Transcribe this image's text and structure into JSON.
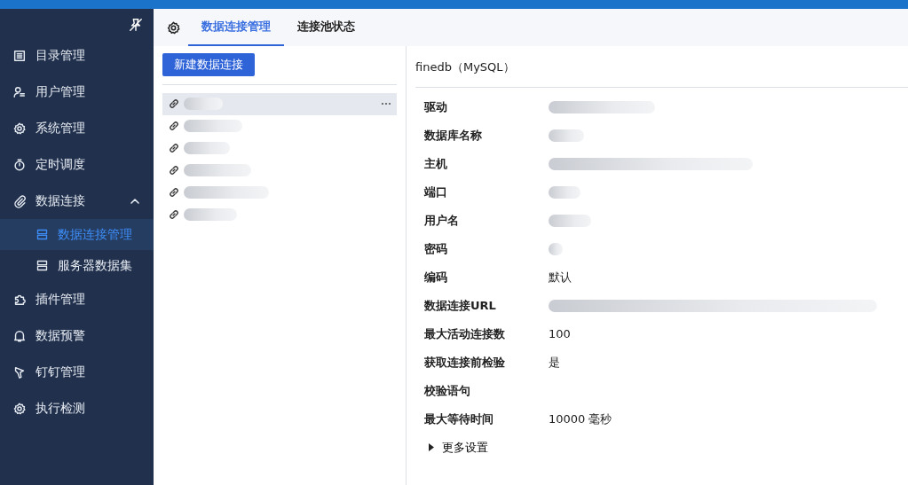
{
  "sidebar": {
    "items": [
      {
        "label": "目录管理"
      },
      {
        "label": "用户管理"
      },
      {
        "label": "系统管理"
      },
      {
        "label": "定时调度"
      },
      {
        "label": "数据连接",
        "expanded": true,
        "children": [
          {
            "label": "数据连接管理",
            "selected": true
          },
          {
            "label": "服务器数据集",
            "selected": false
          }
        ]
      },
      {
        "label": "插件管理"
      },
      {
        "label": "数据预警"
      },
      {
        "label": "钉钉管理"
      },
      {
        "label": "执行检测"
      }
    ]
  },
  "tabs": [
    {
      "label": "数据连接管理",
      "selected": true
    },
    {
      "label": "连接池状态",
      "selected": false
    }
  ],
  "new_button": "新建数据连接",
  "connections": [
    {
      "selected": true
    },
    {
      "selected": false
    },
    {
      "selected": false
    },
    {
      "selected": false
    },
    {
      "selected": false
    },
    {
      "selected": false
    }
  ],
  "detail": {
    "title": "finedb（MySQL）",
    "fields": [
      {
        "label": "驱动",
        "redacted": true
      },
      {
        "label": "数据库名称",
        "redacted": true
      },
      {
        "label": "主机",
        "redacted": true
      },
      {
        "label": "端口",
        "redacted": true
      },
      {
        "label": "用户名",
        "redacted": true
      },
      {
        "label": "密码",
        "redacted": true
      },
      {
        "label": "编码",
        "value": "默认"
      },
      {
        "label": "数据连接URL",
        "redacted": true
      },
      {
        "label": "最大活动连接数",
        "value": "100"
      },
      {
        "label": "获取连接前检验",
        "value": "是"
      },
      {
        "label": "校验语句"
      },
      {
        "label": "最大等待时间",
        "value": "10000 毫秒"
      }
    ],
    "more": {
      "label": "更多设置",
      "expanded": false
    }
  }
}
